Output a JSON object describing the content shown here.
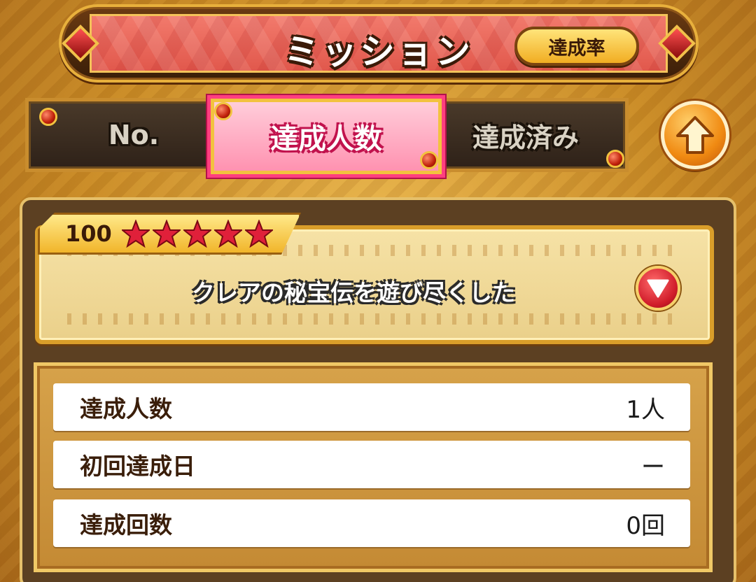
{
  "header": {
    "title": "ミッション",
    "rate_button_label": "達成率"
  },
  "tabs": [
    {
      "label": "No.",
      "active": false
    },
    {
      "label": "達成人数",
      "active": true
    },
    {
      "label": "達成済み",
      "active": false
    }
  ],
  "scroll_top_icon": "arrow-up-icon",
  "mission": {
    "level": "100",
    "stars": 5,
    "title": "クレアの秘宝伝を遊び尽くした",
    "expand_icon": "triangle-down-icon"
  },
  "stats": [
    {
      "label": "達成人数",
      "value": "1人"
    },
    {
      "label": "初回達成日",
      "value": "ー"
    },
    {
      "label": "達成回数",
      "value": "0回"
    }
  ],
  "colors": {
    "active_tab": "#ff8fae",
    "header_banner": "#e1584c",
    "star": "#e0203a",
    "gold": "#f1b52a"
  }
}
